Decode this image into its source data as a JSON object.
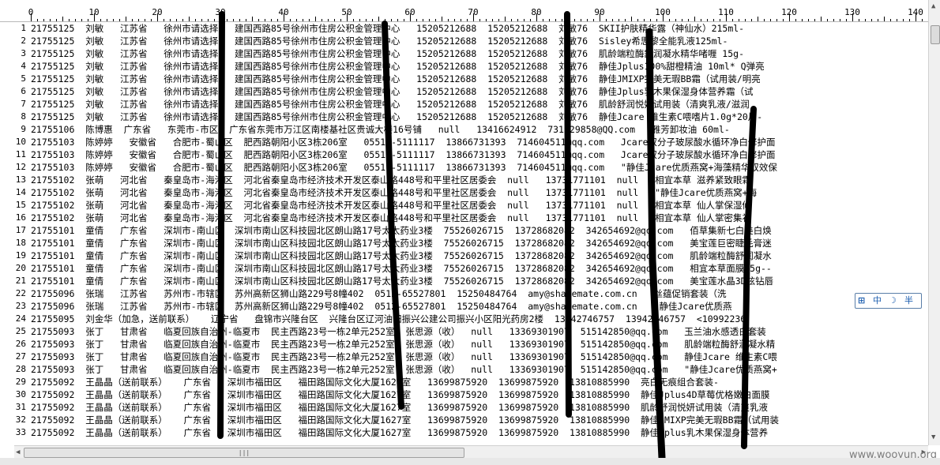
{
  "ruler": {
    "labels": [
      "0",
      "10",
      "20",
      "30",
      "40",
      "50",
      "60",
      "70",
      "80",
      "90",
      "100",
      "110",
      "120",
      "130",
      "140"
    ]
  },
  "lines": [
    {
      "n": "1",
      "text": "21755125  刘敏   江苏省   徐州市请选择   建国西路85号徐州市住房公积金管理中心   15205212688  15205212688  刘敏76  SKII护肤精华露（神仙水）215ml-"
    },
    {
      "n": "2",
      "text": "21755125  刘敏   江苏省   徐州市请选择   建国西路85号徐州市住房公积金管理中心   15205212688  15205212688  刘敏76  Sisley希思黎全能乳液125ml-"
    },
    {
      "n": "3",
      "text": "21755125  刘敏   江苏省   徐州市请选择   建国西路85号徐州市住房公积金管理中心   15205212688  15205212688  刘敏76  肌龄端粒酶舒润凝水精华啫喱 15g-"
    },
    {
      "n": "4",
      "text": "21755125  刘敏   江苏省   徐州市请选择   建国西路85号徐州市住房公积金管理中心   15205212688  15205212688  刘敏76  静佳Jplus100%甜橙精油 10ml* Q弹亮"
    },
    {
      "n": "5",
      "text": "21755125  刘敏   江苏省   徐州市请选择   建国西路85号徐州市住房公积金管理中心   15205212688  15205212688  刘敏76  静佳JMIXP完美无瑕BB霜（试用装/明亮"
    },
    {
      "n": "6",
      "text": "21755125  刘敏   江苏省   徐州市请选择   建国西路85号徐州市住房公积金管理中心   15205212688  15205212688  刘敏76  静佳Jplus乳木果保湿身体营养霜（试"
    },
    {
      "n": "7",
      "text": "21755125  刘敏   江苏省   徐州市请选择   建国西路85号徐州市住房公积金管理中心   15205212688  15205212688  刘敏76  肌龄舒润悦妍试用装（清爽乳液/滋润"
    },
    {
      "n": "8",
      "text": "21755125  刘敏   江苏省   徐州市请选择   建国西路85号徐州市住房公积金管理中心   15205212688  15205212688  刘敏76  静佳Jcare 维生素C喂嗜片1.0g*20片-"
    },
    {
      "n": "9",
      "text": "21755106  陈博惠  广东省   东莞市-市区  广东省东莞市万江区南楼基社区贵诚大楼16号铺   null   13416624912  731329858@QQ.com   雅芳卸妆油 60ml-"
    },
    {
      "n": "10",
      "text": "21755103  陈婷婷   安徽省   合肥市-蜀山区  肥西路朝阳小区3栋206室   0551--5111117  13866731393  714604511@qq.com   Jcare双分子玻尿酸水循环净白修护面"
    },
    {
      "n": "11",
      "text": "21755103  陈婷婷   安徽省   合肥市-蜀山区  肥西路朝阳小区3栋206室   0551--5111117  13866731393  714604511@qq.com   Jcare双分子玻尿酸水循环净白修护面"
    },
    {
      "n": "12",
      "text": "21755103  陈婷婷   安徽省   合肥市-蜀山区  肥西路朝阳小区3栋206室   0551--5111117  13866731393  714604511@qq.com   \"静佳Jcare优质燕窝+海藻精华双效保"
    },
    {
      "n": "13",
      "text": "21755102  张萌   河北省   秦皇岛市-海港区  河北省秦皇岛市经济技术开发区泰山路448号和平里社区居委会  null   13731771101  null   相宜本草 滋养紧致眼霜"
    },
    {
      "n": "14",
      "text": "21755102  张萌   河北省   秦皇岛市-海港区  河北省秦皇岛市经济技术开发区泰山路448号和平里社区居委会  null   13731771101  null   \"静佳Jcare优质燕窝+海"
    },
    {
      "n": "15",
      "text": "21755102  张萌   河北省   秦皇岛市-海港区  河北省秦皇岛市经济技术开发区泰山路448号和平里社区居委会  null   13731771101  null   相宜本草 仙人掌保湿修"
    },
    {
      "n": "16",
      "text": "21755102  张萌   河北省   秦皇岛市-海港区  河北省秦皇岛市经济技术开发区泰山路448号和平里社区居委会  null   13731771101  null   相宜本草 仙人掌密集补"
    },
    {
      "n": "17",
      "text": "21755101  童倩   广东省   深圳市-南山区  深圳市南山区科技园北区朗山路17号太太药业3楼  75526026715  13728682082  342654692@qq.com   佰草集新七白美白焕"
    },
    {
      "n": "18",
      "text": "21755101  童倩   广东省   深圳市-南山区  深圳市南山区科技园北区朗山路17号太太药业3楼  75526026715  13728682082  342654692@qq.com   美宝莲巨密睫毛膏迷"
    },
    {
      "n": "19",
      "text": "21755101  童倩   广东省   深圳市-南山区  深圳市南山区科技园北区朗山路17号太太药业3楼  75526026715  13728682082  342654692@qq.com   肌龄端粒酶舒润凝水"
    },
    {
      "n": "20",
      "text": "21755101  童倩   广东省   深圳市-南山区  深圳市南山区科技园北区朗山路17号太太药业3楼  75526026715  13728682082  342654692@qq.com   相宜本草面膜25g--"
    },
    {
      "n": "21",
      "text": "21755101  童倩   广东省   深圳市-南山区  深圳市南山区科技园北区朗山路17号太太药业3楼  75526026715  13728682082  342654692@qq.com   美宝莲水晶3D炫钻唇"
    },
    {
      "n": "22",
      "text": "21755096  张瑞   江苏省   苏州市-市辖区  苏州高新区狮山路229号8幢402  0512-65527801  15250484764  amy@sharemate.com.cn   丝蕴促销套装（洗"
    },
    {
      "n": "23",
      "text": "21755096  张瑞   江苏省   苏州市-市辖区  苏州高新区狮山路229号8幢402  0512-65527801  15250484764  amy@sharemate.com.cn   \"静佳Jcare优质燕"
    },
    {
      "n": "24",
      "text": "21755095  刘金华（加急，送前联系）   辽宁省   盘锦市兴隆台区  兴隆台区辽河油田振兴公建公司振兴小区阳光药房2楼  13942746757  13942746757  <10992236"
    },
    {
      "n": "25",
      "text": "21755093  张丁   甘肃省   临夏回族自治州-临夏市  民主西路23号一栋2单元252室  张思源（收）  null   13369301907  515142850@qq.com   玉兰油水感透白套装"
    },
    {
      "n": "26",
      "text": "21755093  张丁   甘肃省   临夏回族自治州-临夏市  民主西路23号一栋2单元252室  张思源（收）  null   13369301907  515142850@qq.com   肌龄端粒酶舒润凝水精"
    },
    {
      "n": "27",
      "text": "21755093  张丁   甘肃省   临夏回族自治州-临夏市  民主西路23号一栋2单元252室  张思源（收）  null   13369301907  515142850@qq.com   静佳Jcare 维生素C喂"
    },
    {
      "n": "28",
      "text": "21755093  张丁   甘肃省   临夏回族自治州-临夏市  民主西路23号一栋2单元252室  张思源（收）  null   13369301907  515142850@qq.com   \"静佳Jcare优质燕窝+"
    },
    {
      "n": "29",
      "text": "21755092  王晶晶（送前联系）   广东省   深圳市福田区   福田路国际文化大厦1627室   13699875920  13699875920  13810885990  亮白无痕组合套装-"
    },
    {
      "n": "30",
      "text": "21755092  王晶晶（送前联系）   广东省   深圳市福田区   福田路国际文化大厦1627室   13699875920  13699875920  13810885990  静佳Jplus4D草莓优格嫩白面膜"
    },
    {
      "n": "31",
      "text": "21755092  王晶晶（送前联系）   广东省   深圳市福田区   福田路国际文化大厦1627室   13699875920  13699875920  13810885990  肌龄舒润悦妍试用装（清爽乳液"
    },
    {
      "n": "32",
      "text": "21755092  王晶晶（送前联系）   广东省   深圳市福田区   福田路国际文化大厦1627室   13699875920  13699875920  13810885990  静佳JMIXP完美无瑕BB霜（试用装"
    },
    {
      "n": "33",
      "text": "21755092  王晶晶（送前联系）   广东省   深圳市福田区   福田路国际文化大厦1627室   13699875920  13699875920  13810885990  静佳Jplus乳木果保湿身体营养"
    }
  ],
  "ime_toolbar": {
    "mode": "中",
    "moon": "☽",
    "fullwidth": "半"
  },
  "hscroll_grip": "|||",
  "watermark": "www.wooyun.org",
  "colors": {
    "redaction": "#000000",
    "background": "#ffffff",
    "scrollbar": "#f0f0f0"
  }
}
